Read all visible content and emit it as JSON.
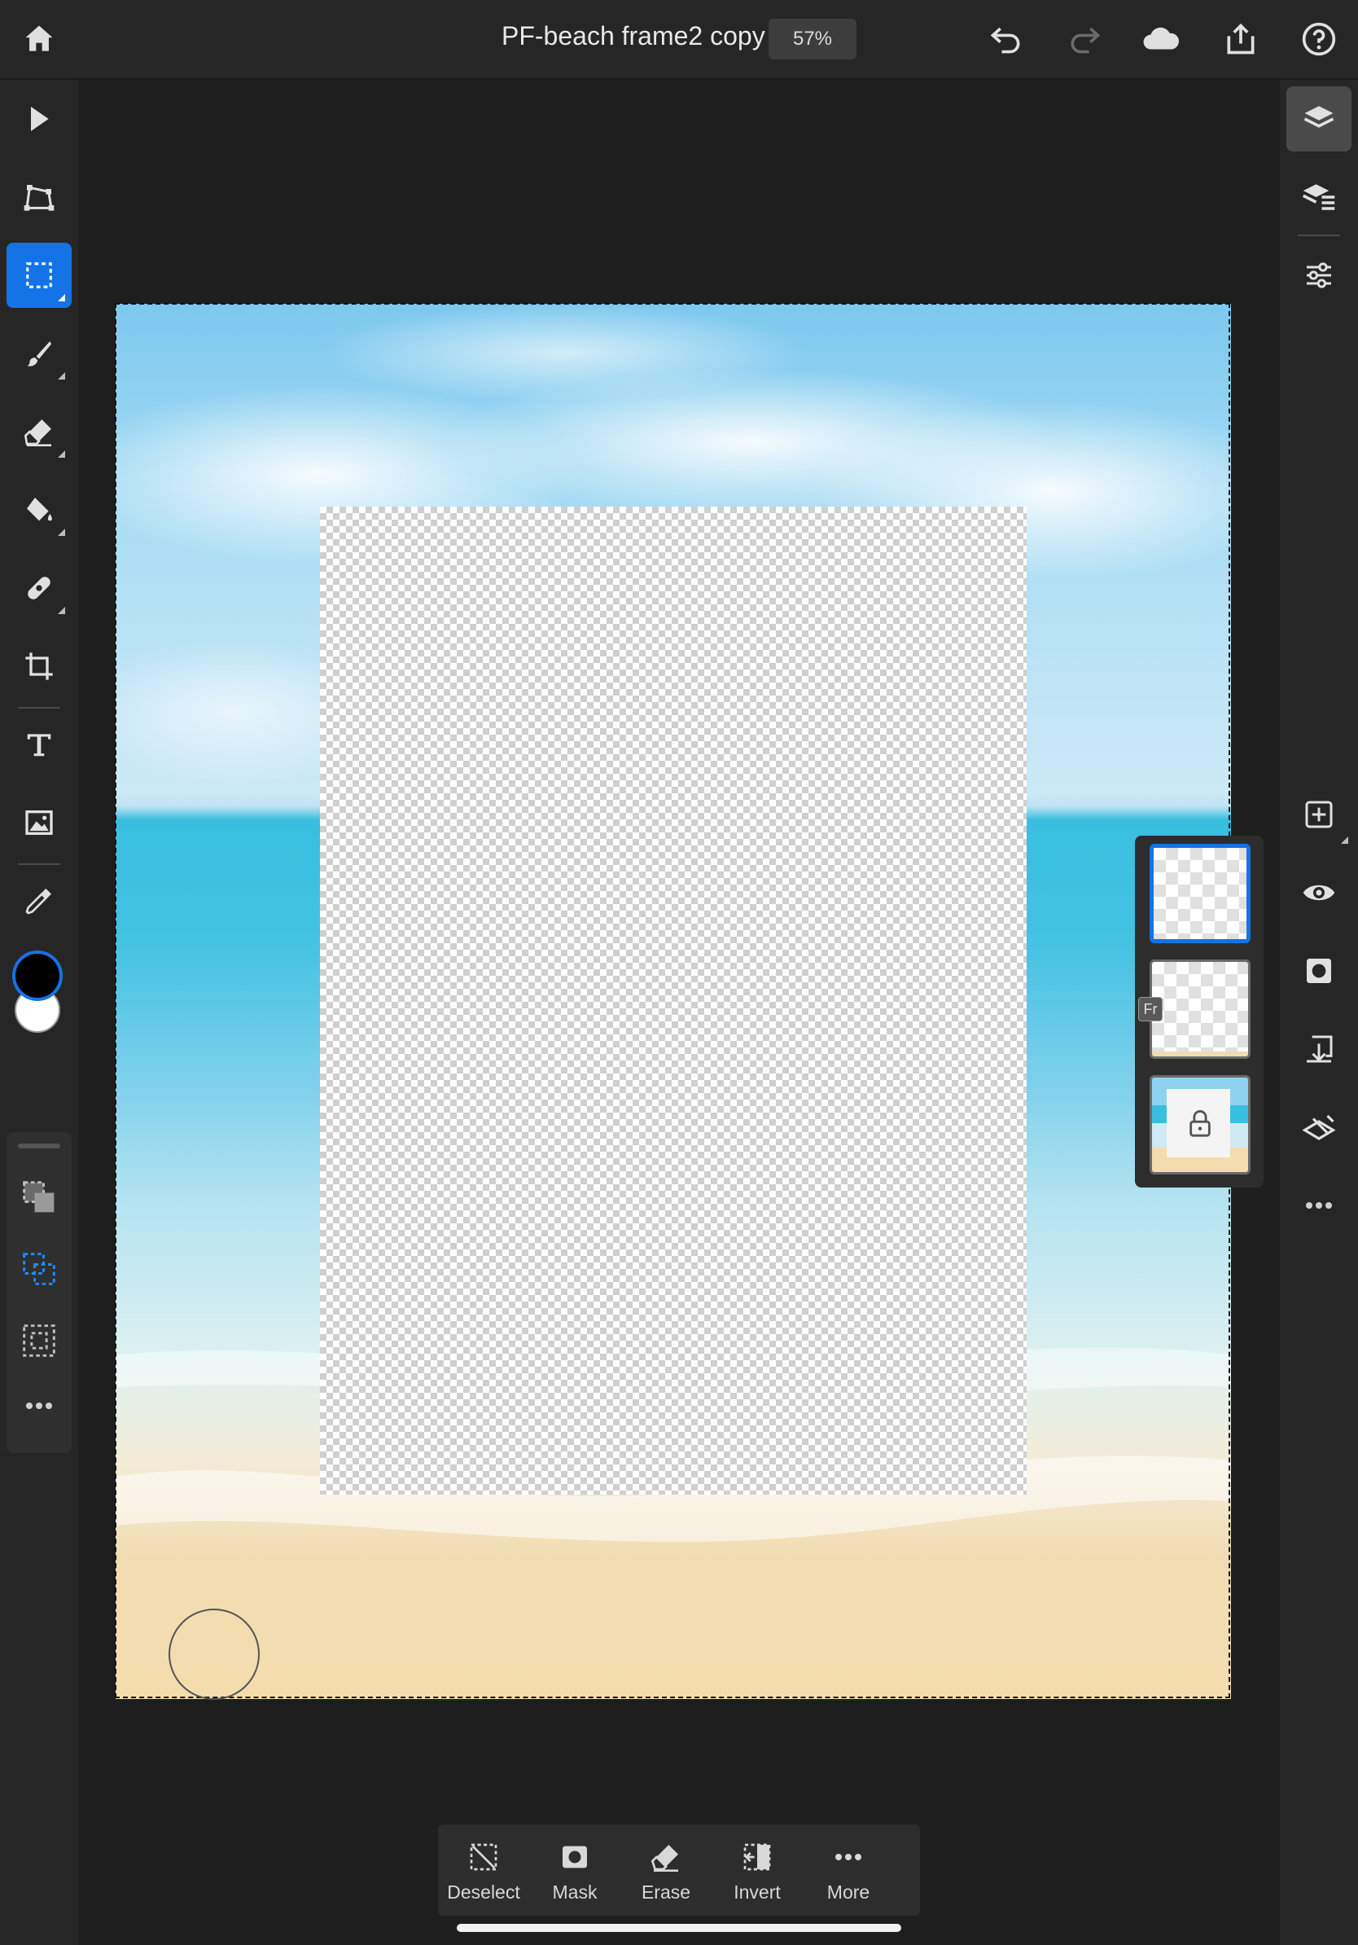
{
  "document": {
    "title": "PF-beach frame2 copy",
    "zoom": "57%"
  },
  "topbar": {
    "home": "home-icon",
    "undo": "undo-icon",
    "redo": "redo-icon",
    "cloud": "cloud-icon",
    "share": "share-icon",
    "help": "help-icon"
  },
  "left_toolbar": {
    "tools": [
      "move",
      "transform",
      "selection",
      "brush",
      "eraser",
      "fill",
      "healing",
      "crop",
      "type",
      "place-image",
      "eyedropper"
    ],
    "active_tool": "selection",
    "foreground_color": "#000000",
    "background_color": "#ffffff",
    "selection_modes": [
      "new-selection",
      "add-to-selection",
      "subtract-from-selection"
    ],
    "more": "more-icon"
  },
  "right_toolbar": {
    "tools": [
      "layers",
      "layer-details",
      "properties",
      "add-layer",
      "visibility",
      "mask",
      "import",
      "adjust",
      "more"
    ],
    "active": "layers"
  },
  "layers": [
    {
      "name": "empty-layer",
      "selected": true,
      "locked": false,
      "badge": ""
    },
    {
      "name": "frame-layer",
      "selected": false,
      "locked": false,
      "badge": "Fr"
    },
    {
      "name": "beach-background",
      "selected": false,
      "locked": true,
      "badge": ""
    }
  ],
  "selection_bar": {
    "deselect": "Deselect",
    "mask": "Mask",
    "erase": "Erase",
    "invert": "Invert",
    "more": "More"
  },
  "colors": {
    "accent": "#1473e6",
    "chrome": "#262626",
    "workspace": "#1e1e1e"
  }
}
